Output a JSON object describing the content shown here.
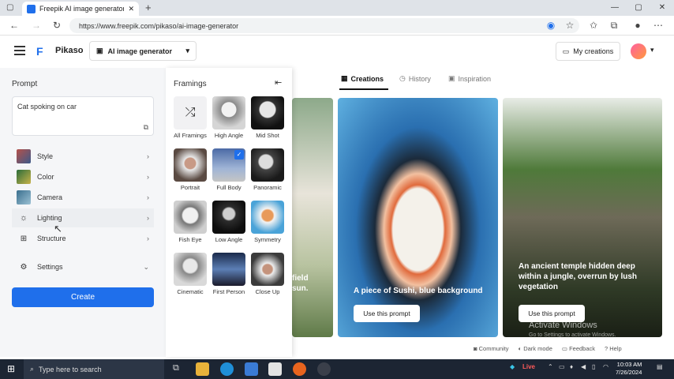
{
  "browser": {
    "tab_title": "Freepik AI image generator - Fre",
    "url": "https://www.freepik.com/pikaso/ai-image-generator"
  },
  "header": {
    "brand": "Pikaso",
    "tool": "AI image generator",
    "my_creations": "My creations"
  },
  "left_panel": {
    "prompt_title": "Prompt",
    "prompt_value": "Cat spoking on car",
    "menu": [
      {
        "label": "Style"
      },
      {
        "label": "Color"
      },
      {
        "label": "Camera"
      },
      {
        "label": "Lighting"
      },
      {
        "label": "Structure"
      }
    ],
    "settings_label": "Settings",
    "create_label": "Create"
  },
  "framings": {
    "title": "Framings",
    "items": [
      {
        "label": "All Framings"
      },
      {
        "label": "High Angle"
      },
      {
        "label": "Mid Shot"
      },
      {
        "label": "Portrait"
      },
      {
        "label": "Full Body"
      },
      {
        "label": "Panoramic"
      },
      {
        "label": "Fish Eye"
      },
      {
        "label": "Low Angle"
      },
      {
        "label": "Symmetry"
      },
      {
        "label": "Cinematic"
      },
      {
        "label": "First Person"
      },
      {
        "label": "Close Up"
      }
    ]
  },
  "main": {
    "tabs": [
      {
        "label": "Creations"
      },
      {
        "label": "History"
      },
      {
        "label": "Inspiration"
      }
    ],
    "cards": [
      {
        "text_line1": "field",
        "text_line2": "sun."
      },
      {
        "text": "A piece of Sushi, blue background",
        "button": "Use this prompt"
      },
      {
        "text": "An ancient temple hidden deep within a jungle, overrun by lush vegetation",
        "button": "Use this prompt"
      }
    ],
    "footer": {
      "community": "Community",
      "dark_mode": "Dark mode",
      "feedback": "Feedback",
      "help": "Help"
    },
    "watermark": "Activate Windows",
    "watermark_sub": "Go to Settings to activate Windows."
  },
  "taskbar": {
    "search_placeholder": "Type here to search",
    "live": "Live",
    "time": "10:03 AM",
    "date": "7/26/2024"
  },
  "colors": {
    "accent": "#1f6feb",
    "taskbar": "#1c2533"
  }
}
